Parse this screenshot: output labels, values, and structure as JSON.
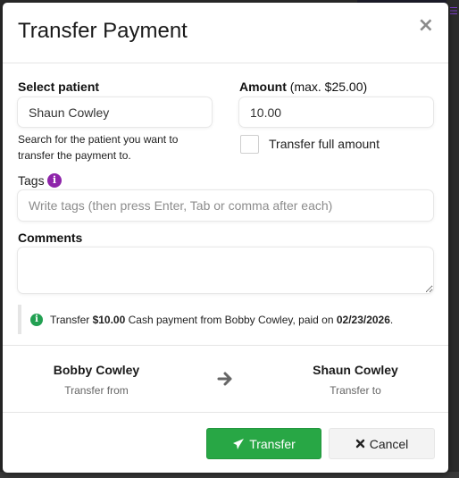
{
  "modal": {
    "title": "Transfer Payment",
    "close_glyph": "×"
  },
  "form": {
    "patient_label": "Select patient",
    "patient_value": "Shaun Cowley",
    "patient_help": "Search for the patient you want to transfer the payment to.",
    "amount_label": "Amount",
    "amount_hint": "(max. $25.00)",
    "amount_value": "10.00",
    "full_amount_label": "Transfer full amount",
    "full_amount_checked": false,
    "tags_label": "Tags",
    "tags_info_icon": "info-circle",
    "tags_placeholder": "Write tags (then press Enter, Tab or comma after each)",
    "comments_label": "Comments",
    "comments_value": ""
  },
  "notice": {
    "icon": "info-circle",
    "prefix": "Transfer ",
    "amount": "$10.00",
    "middle": " Cash payment from Bobby Cowley, paid on ",
    "date": "02/23/2026",
    "suffix": "."
  },
  "parties": {
    "from_name": "Bobby Cowley",
    "from_caption": "Transfer from",
    "to_name": "Shaun Cowley",
    "to_caption": "Transfer to",
    "arrow_icon": "arrow-right"
  },
  "buttons": {
    "transfer_label": "Transfer",
    "transfer_icon": "paper-plane",
    "cancel_label": "Cancel",
    "cancel_icon": "times"
  },
  "colors": {
    "primary_green": "#28a745",
    "tags_info_purple": "#8e24aa",
    "notice_icon_green": "#22a052"
  }
}
